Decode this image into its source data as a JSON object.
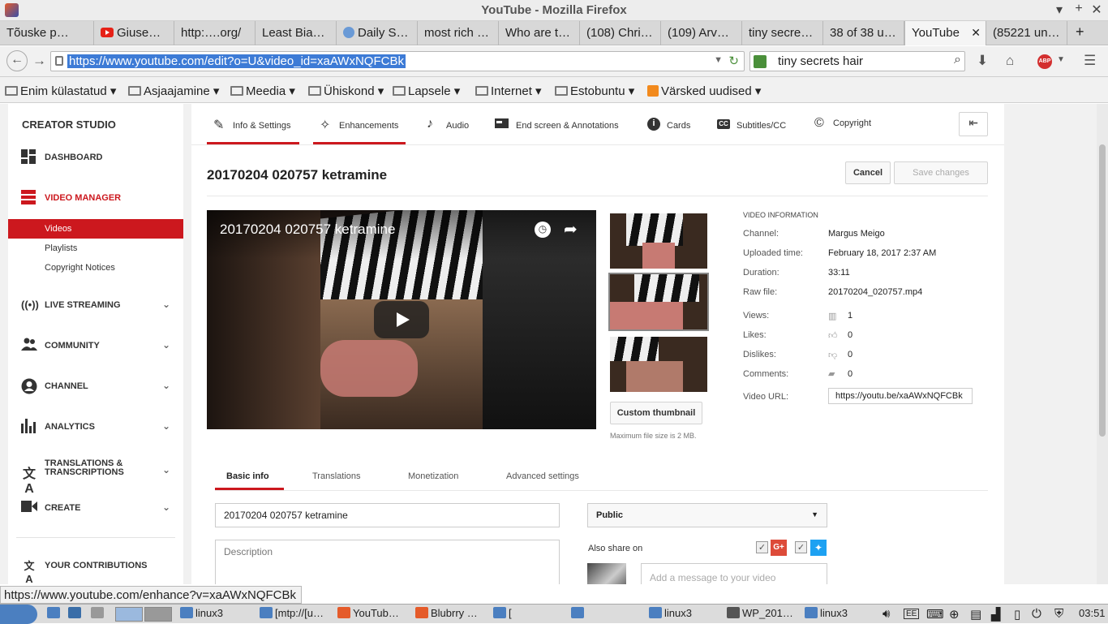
{
  "window": {
    "title": "YouTube - Mozilla Firefox"
  },
  "tabs": [
    {
      "label": "Tõuske p…"
    },
    {
      "label": "Giuse…"
    },
    {
      "label": "http:….org/"
    },
    {
      "label": "Least Bia…"
    },
    {
      "label": "Daily S…"
    },
    {
      "label": "most rich …"
    },
    {
      "label": "Who are t…"
    },
    {
      "label": "(108) Chri…"
    },
    {
      "label": "(109) Arv…"
    },
    {
      "label": "tiny secre…"
    },
    {
      "label": "38 of 38 u…"
    },
    {
      "label": "YouTube"
    },
    {
      "label": "(85221 un…"
    }
  ],
  "nav": {
    "url": "https://www.youtube.com/edit?o=U&video_id=xaAWxNQFCBk",
    "search_value": "tiny secrets hair"
  },
  "bookmarks": [
    {
      "label": "Enim külastatud"
    },
    {
      "label": "Asjaajamine"
    },
    {
      "label": "Meedia"
    },
    {
      "label": "Ühiskond"
    },
    {
      "label": "Lapsele"
    },
    {
      "label": "Internet"
    },
    {
      "label": "Estobuntu"
    },
    {
      "label": "Värsked uudised"
    }
  ],
  "sidebar": {
    "header": "CREATOR STUDIO",
    "dashboard": "DASHBOARD",
    "video_manager": "VIDEO MANAGER",
    "videos": "Videos",
    "playlists": "Playlists",
    "copyright_notices": "Copyright Notices",
    "live_streaming": "LIVE STREAMING",
    "community": "COMMUNITY",
    "channel": "CHANNEL",
    "analytics": "ANALYTICS",
    "translations_1": "TRANSLATIONS &",
    "translations_2": "TRANSCRIPTIONS",
    "create": "CREATE",
    "contributions": "YOUR CONTRIBUTIONS"
  },
  "editor_tabs": {
    "info": "Info & Settings",
    "enhancements": "Enhancements",
    "audio": "Audio",
    "endscreen": "End screen & Annotations",
    "cards": "Cards",
    "subtitles": "Subtitles/CC",
    "copyright": "Copyright"
  },
  "video": {
    "title": "20170204 020757 ketramine",
    "cancel": "Cancel",
    "save": "Save changes",
    "player_title": "20170204 020757 ketramine",
    "custom_thumbnail": "Custom thumbnail",
    "max_size": "Maximum file size is 2 MB."
  },
  "info": {
    "header": "VIDEO INFORMATION",
    "channel_label": "Channel:",
    "channel": "Margus Meigo",
    "uploaded_label": "Uploaded time:",
    "uploaded": "February 18, 2017 2:37 AM",
    "duration_label": "Duration:",
    "duration": "33:11",
    "raw_label": "Raw file:",
    "raw": "20170204_020757.mp4",
    "views_label": "Views:",
    "views": "1",
    "likes_label": "Likes:",
    "likes": "0",
    "dislikes_label": "Dislikes:",
    "dislikes": "0",
    "comments_label": "Comments:",
    "comments": "0",
    "url_label": "Video URL:",
    "url": "https://youtu.be/xaAWxNQFCBk"
  },
  "basic_tabs": {
    "basic": "Basic info",
    "translations": "Translations",
    "monetization": "Monetization",
    "advanced": "Advanced settings"
  },
  "form": {
    "title_value": "20170204 020757  ketramine",
    "description_placeholder": "Description",
    "privacy": "Public",
    "share_label": "Also share on",
    "message_placeholder": "Add a message to your video"
  },
  "status": {
    "link": "https://www.youtube.com/enhance?v=xaAWxNQFCBk"
  },
  "taskbar": {
    "items": [
      "linux3",
      "[mtp://[u…",
      "YouTub…",
      "Blubrry …",
      "[",
      "linux3",
      "WP_201…",
      "linux3"
    ],
    "kb": "EE",
    "clock": "03:51"
  },
  "colors": {
    "accent": "#cc181e",
    "url_highlight": "#3d7bd6"
  }
}
